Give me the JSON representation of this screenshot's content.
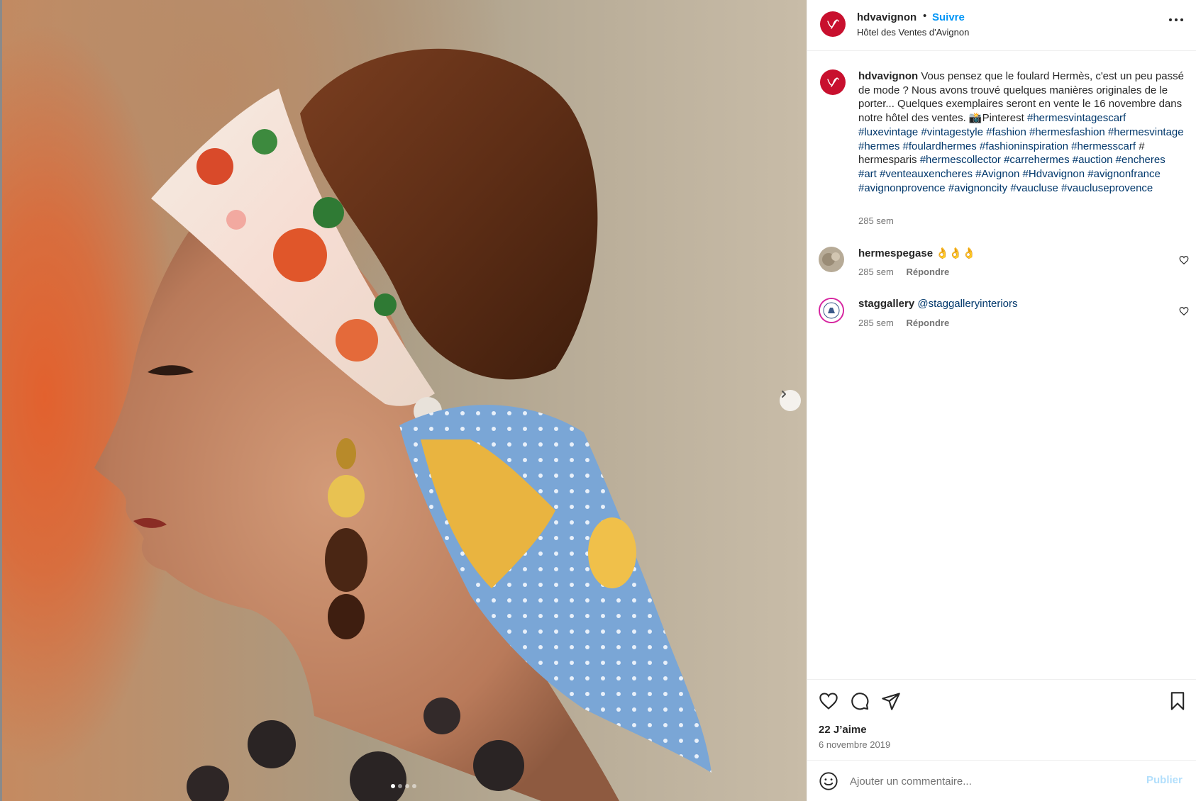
{
  "post": {
    "username": "hdvavignon",
    "separator": "•",
    "follow_label": "Suivre",
    "subtitle": "Hôtel des Ventes d'Avignon",
    "more_icon": "more-options-icon",
    "image_alt": "Femme de profil portant un foulard Hermès dans les cheveux",
    "carousel": {
      "count": 4,
      "active": 1
    }
  },
  "caption": {
    "username": "hdvavignon",
    "text": "Vous pensez que le foulard Hermès, c'est un peu passé de mode ? Nous avons trouvé quelques manières originales de le porter... Quelques exemplaires seront en vente le 16 novembre dans notre hôtel des ventes. 📸Pinterest",
    "tags_1": "#hermesvintagescarf #luxevintage #vintagestyle #fashion #hermesfashion #hermesvintage #hermes #foulardhermes #fashioninspiration #hermesscarf",
    "plain_tag": "# hermesparis",
    "tags_2": "#hermescollector #carrehermes #auction #encheres #art #venteauxencheres #Avignon #Hdvavignon #avignonfrance #avignonprovence #avignoncity #vaucluse #vaucluseprovence",
    "time": "285 sem"
  },
  "comments": [
    {
      "username": "hermespegase",
      "text": "👌👌👌",
      "time": "285 sem",
      "reply_label": "Répondre"
    },
    {
      "username": "staggallery",
      "text": "@staggalleryinteriors",
      "time": "285 sem",
      "reply_label": "Répondre"
    }
  ],
  "footer": {
    "likes": "22 J’aime",
    "date": "6 novembre 2019",
    "comment_placeholder": "Ajouter un commentaire...",
    "publish_label": "Publier"
  },
  "colors": {
    "brand": "#c8102e",
    "link": "#0095f6",
    "hashtag": "#00376b",
    "muted": "#737373"
  }
}
